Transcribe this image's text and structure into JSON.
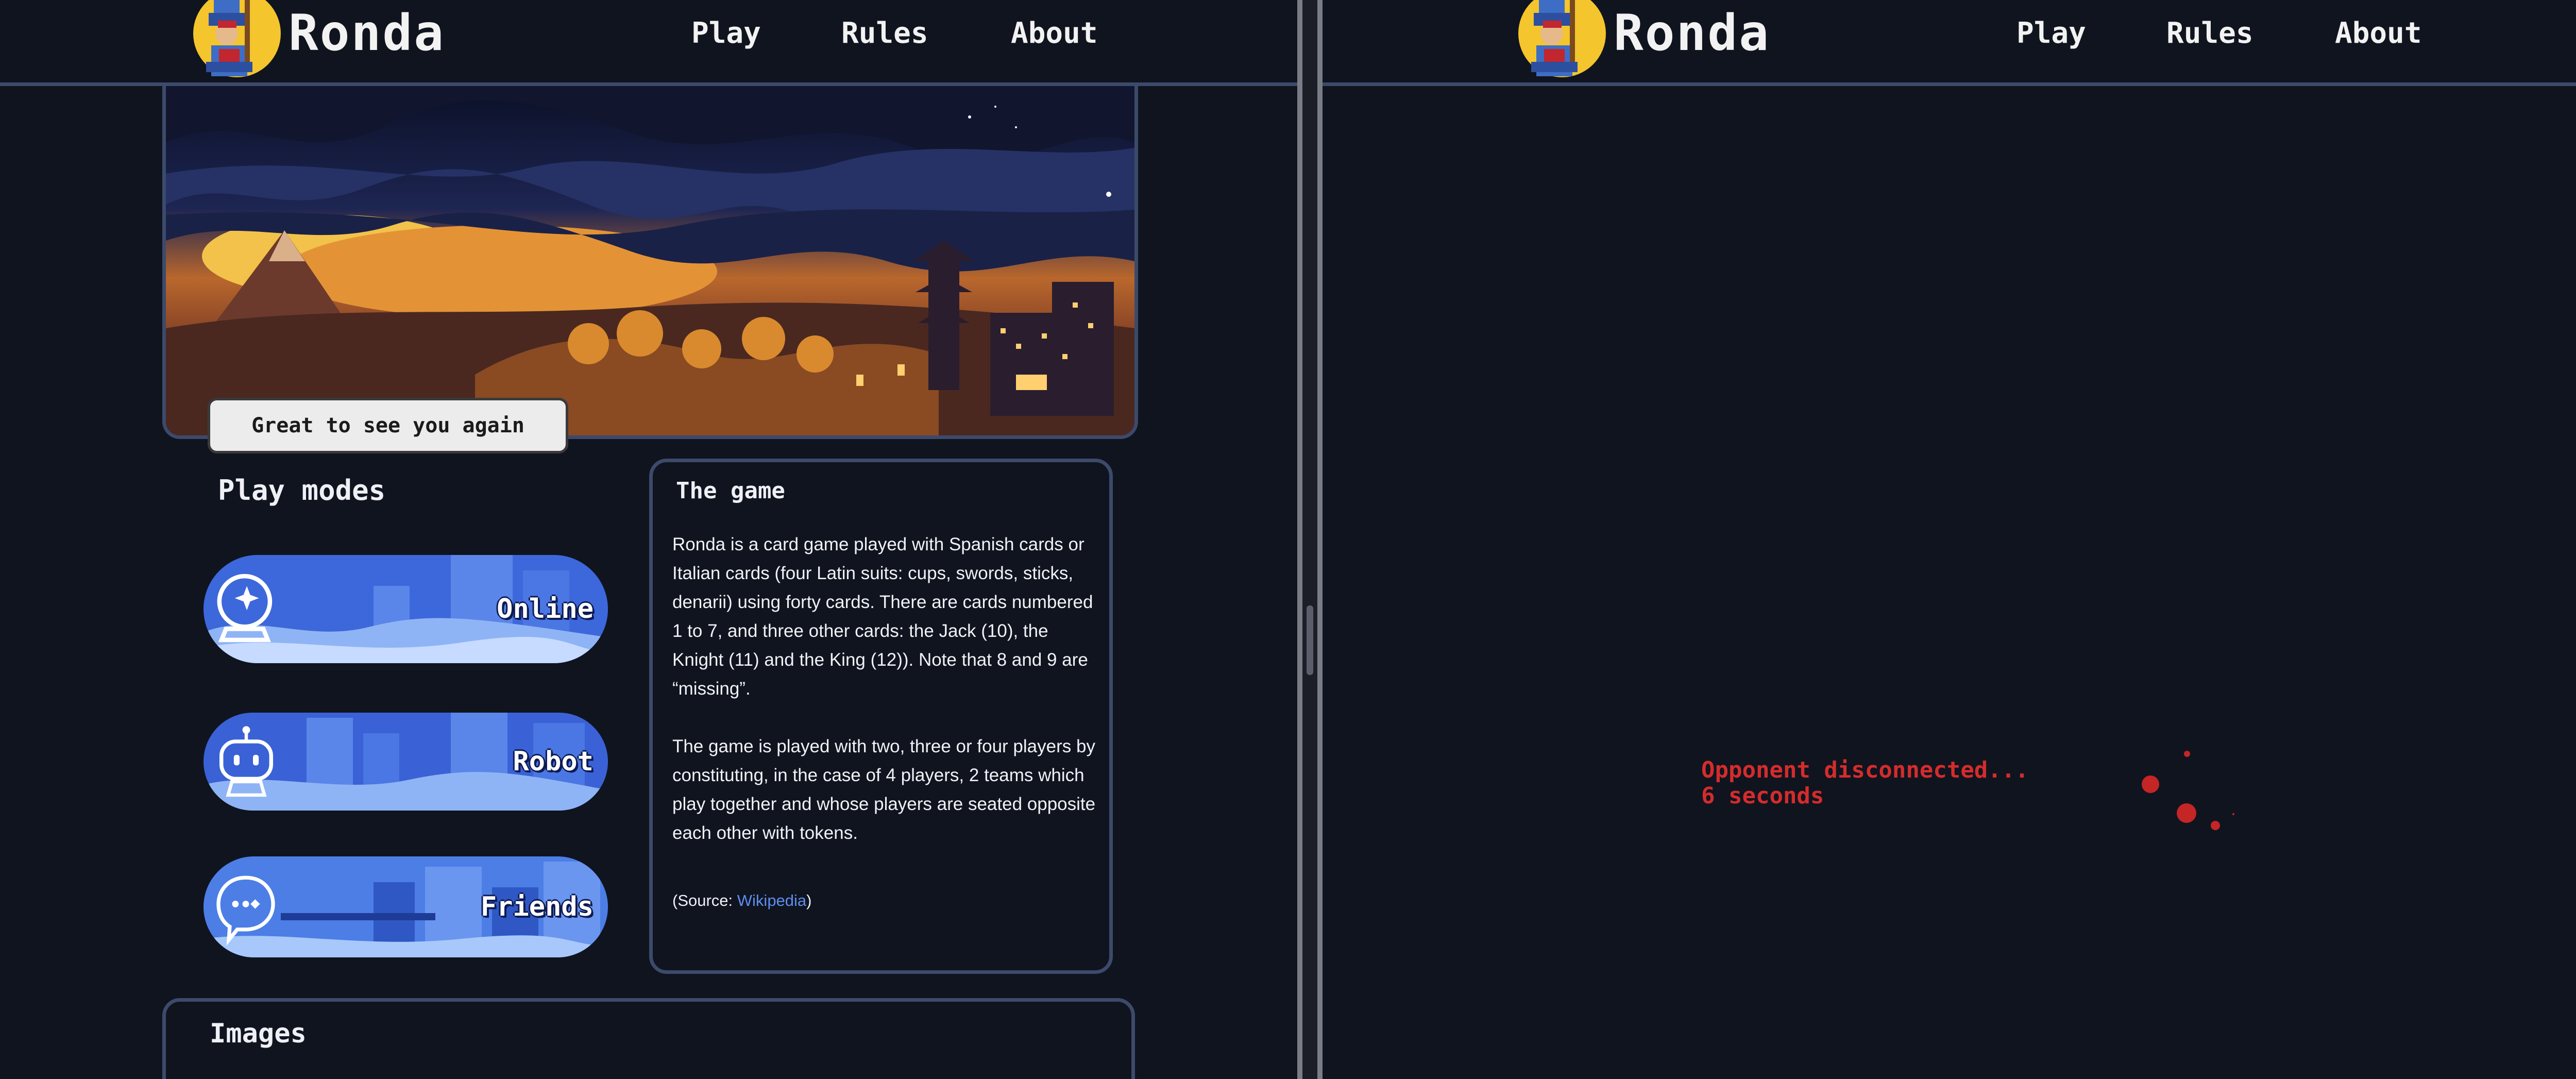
{
  "header": {
    "brand": "Ronda",
    "nav": [
      "Play",
      "Rules",
      "About"
    ],
    "logo_icon": "ronda-king-logo"
  },
  "home": {
    "greeting": "Great to see you again",
    "play_modes_title": "Play modes",
    "modes": [
      {
        "label": "Online",
        "icon": "crystal-ball-icon"
      },
      {
        "label": "Robot",
        "icon": "robot-icon"
      },
      {
        "label": "Friends",
        "icon": "chat-bubble-icon"
      }
    ],
    "game": {
      "title": "The game",
      "paragraph1": "Ronda is a card game played with Spanish cards or Italian cards (four Latin suits: cups, swords, sticks, denarii) using forty cards. There are cards numbered 1 to 7, and three other cards: the Jack (10), the Knight (11) and the King (12)). Note that 8 and 9 are “missing”.",
      "paragraph2": "The game is played with two, three or four players by constituting, in the case of 4 players, 2 teams which play together and whose players are seated opposite each other with tokens.",
      "source_prefix": "(Source: ",
      "source_link": "Wikipedia",
      "source_suffix": ")"
    },
    "images_title": "Images"
  },
  "game_view": {
    "status_line1": "Opponent disconnected...",
    "status_line2": "6 seconds"
  },
  "colors": {
    "background": "#10141f",
    "border": "#3c4a6b",
    "status_red": "#d42c2c",
    "link_blue": "#5d8ef0",
    "mode_button_blue": "#3d68db"
  }
}
